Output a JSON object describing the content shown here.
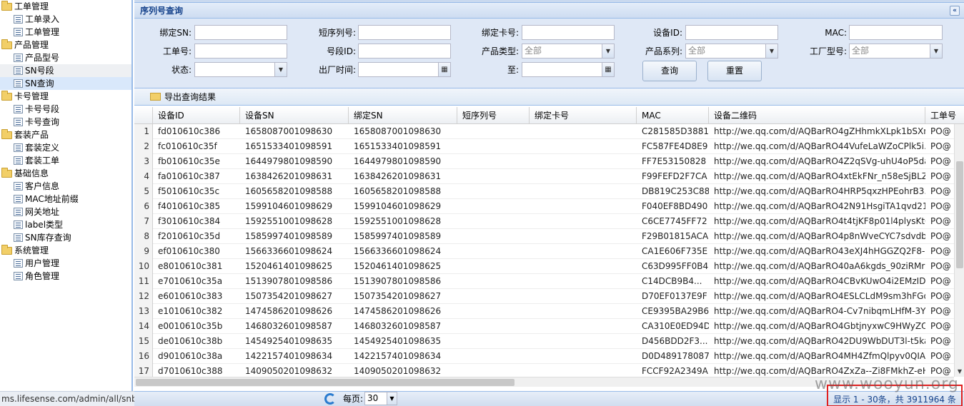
{
  "sidebar": {
    "groups": [
      {
        "label": "工单管理",
        "items": [
          "工单录入",
          "工单管理"
        ]
      },
      {
        "label": "产品管理",
        "items": [
          "产品型号",
          "SN号段",
          "SN查询"
        ]
      },
      {
        "label": "卡号管理",
        "items": [
          "卡号号段",
          "卡号查询"
        ]
      },
      {
        "label": "套装产品",
        "items": [
          "套装定义",
          "套装工单"
        ]
      },
      {
        "label": "基础信息",
        "items": [
          "客户信息",
          "MAC地址前缀",
          "网关地址",
          "label类型",
          "SN库存查询"
        ]
      },
      {
        "label": "系统管理",
        "items": [
          "用户管理",
          "角色管理"
        ]
      }
    ],
    "hover_item": "SN号段",
    "selected_item": "SN查询"
  },
  "panel": {
    "title": "序列号查询",
    "collapse_glyph": "«"
  },
  "form": {
    "labels": {
      "bind_sn": "绑定SN:",
      "short_serial": "短序列号:",
      "bind_card": "绑定卡号:",
      "device_id": "设备ID:",
      "mac": "MAC:",
      "work_order_no": "工单号:",
      "segment_id": "号段ID:",
      "product_type": "产品类型:",
      "product_series": "产品系列:",
      "factory_model": "工厂型号:",
      "status": "状态:",
      "factory_time": "出厂时间:",
      "to": "至:"
    },
    "select_values": {
      "product_type": "全部",
      "product_series": "全部",
      "factory_model": "全部"
    },
    "buttons": {
      "query": "查询",
      "reset": "重置"
    }
  },
  "toolbar": {
    "export_label": "导出查询结果"
  },
  "table": {
    "columns": [
      "设备ID",
      "设备SN",
      "绑定SN",
      "短序列号",
      "绑定卡号",
      "MAC",
      "设备二维码",
      "工单号"
    ],
    "rows": [
      [
        "1",
        "fd010610c386",
        "1658087001098630",
        "1658087001098630",
        "",
        "",
        "C281585D3881",
        "http://we.qq.com/d/AQBarRO4gZHhmkXLpk1bSXn...",
        "PO@"
      ],
      [
        "2",
        "fc010610c35f",
        "1651533401098591",
        "1651533401098591",
        "",
        "",
        "FC587FE4D8E9",
        "http://we.qq.com/d/AQBarRO44VufeLaWZoCPlk5i...",
        "PO@"
      ],
      [
        "3",
        "fb010610c35e",
        "1644979801098590",
        "1644979801098590",
        "",
        "",
        "FF7E53150828",
        "http://we.qq.com/d/AQBarRO4Z2qSVg-uhU4oP5dal...",
        "PO@"
      ],
      [
        "4",
        "fa010610c387",
        "1638426201098631",
        "1638426201098631",
        "",
        "",
        "F99FEFD2F7CA",
        "http://we.qq.com/d/AQBarRO4xtEkFNr_n58eSjBLZs...",
        "PO@"
      ],
      [
        "5",
        "f5010610c35c",
        "1605658201098588",
        "1605658201098588",
        "",
        "",
        "DB819C253C88",
        "http://we.qq.com/d/AQBarRO4HRP5qxzHPEohrB3...",
        "PO@"
      ],
      [
        "6",
        "f4010610c385",
        "1599104601098629",
        "1599104601098629",
        "",
        "",
        "F040EF8BD490",
        "http://we.qq.com/d/AQBarRO42N91HsgiTA1qvd21c...",
        "PO@"
      ],
      [
        "7",
        "f3010610c384",
        "1592551001098628",
        "1592551001098628",
        "",
        "",
        "C6CE7745FF72",
        "http://we.qq.com/d/AQBarRO4t4tjKF8p01l4plysKtG...",
        "PO@"
      ],
      [
        "8",
        "f2010610c35d",
        "1585997401098589",
        "1585997401098589",
        "",
        "",
        "F29B01815ACA",
        "http://we.qq.com/d/AQBarRO4p8nWveCYC7sdvdbY...",
        "PO@"
      ],
      [
        "9",
        "ef010610c380",
        "1566336601098624",
        "1566336601098624",
        "",
        "",
        "CA1E606F735E",
        "http://we.qq.com/d/AQBarRO43eXJ4hHGGZQ2F8-...",
        "PO@"
      ],
      [
        "10",
        "e8010610c381",
        "1520461401098625",
        "1520461401098625",
        "",
        "",
        "C63D995FF0B4",
        "http://we.qq.com/d/AQBarRO40aA6kgds_90ziRMr1...",
        "PO@"
      ],
      [
        "11",
        "e7010610c35a",
        "1513907801098586",
        "1513907801098586",
        "",
        "",
        "C14DCB9B4...",
        "http://we.qq.com/d/AQBarRO4CBvKUwO4i2EMzIDV...",
        "PO@"
      ],
      [
        "12",
        "e6010610c383",
        "1507354201098627",
        "1507354201098627",
        "",
        "",
        "D70EF0137E9F",
        "http://we.qq.com/d/AQBarRO4ESLCLdM9sm3hFGo...",
        "PO@"
      ],
      [
        "13",
        "e1010610c382",
        "1474586201098626",
        "1474586201098626",
        "",
        "",
        "CE9395BA29B6",
        "http://we.qq.com/d/AQBarRO4-Cv7nibqmLHfM-3Y2...",
        "PO@"
      ],
      [
        "14",
        "e0010610c35b",
        "1468032601098587",
        "1468032601098587",
        "",
        "",
        "CA310E0ED94D",
        "http://we.qq.com/d/AQBarRO4GbtjnyxwC9HWyZO0...",
        "PO@"
      ],
      [
        "15",
        "de010610c38b",
        "1454925401098635",
        "1454925401098635",
        "",
        "",
        "D456BDD2F3...",
        "http://we.qq.com/d/AQBarRO42DU9WbDUT3l-t5ka...",
        "PO@"
      ],
      [
        "16",
        "d9010610c38a",
        "1422157401098634",
        "1422157401098634",
        "",
        "",
        "D0D489178087",
        "http://we.qq.com/d/AQBarRO4MH4ZfmQlpyv0QIAlPv...",
        "PO@"
      ],
      [
        "17",
        "d7010610c388",
        "1409050201098632",
        "1409050201098632",
        "",
        "",
        "FCCF92A2349A",
        "http://we.qq.com/d/AQBarRO4ZxZa--Zi8FMkhZ-eH2...",
        "PO@"
      ]
    ]
  },
  "paging": {
    "per_page_label": "每页:",
    "per_page_value": "30",
    "display_info": "显示 1 - 30条，共 3911964 条"
  },
  "status_bar": {
    "url": "ms.lifesense.com/admin/all/snbatch.jsp"
  },
  "watermark": "www.wooyun.org"
}
